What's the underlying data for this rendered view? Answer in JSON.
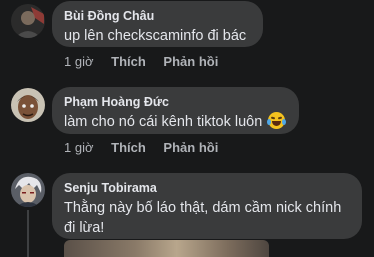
{
  "comments": [
    {
      "name": "Bùi Đồng Châu",
      "text": "up lên checkscaminfo đi bác",
      "time": "1 giờ",
      "like": "Thích",
      "reply": "Phản hồi"
    },
    {
      "name": "Phạm Hoàng Đức",
      "text": "làm cho nó cái kênh tiktok luôn",
      "time": "1 giờ",
      "like": "Thích",
      "reply": "Phản hồi"
    },
    {
      "name": "Senju Tobirama",
      "text_line1": "Thằng này bố láo thật, dám cầm nick chính",
      "text_line2": "đi lừa!"
    }
  ],
  "colors": {
    "background": "#18191a",
    "bubble": "#3a3b3c",
    "text": "#e4e6eb",
    "secondary": "#b0b3b8"
  }
}
